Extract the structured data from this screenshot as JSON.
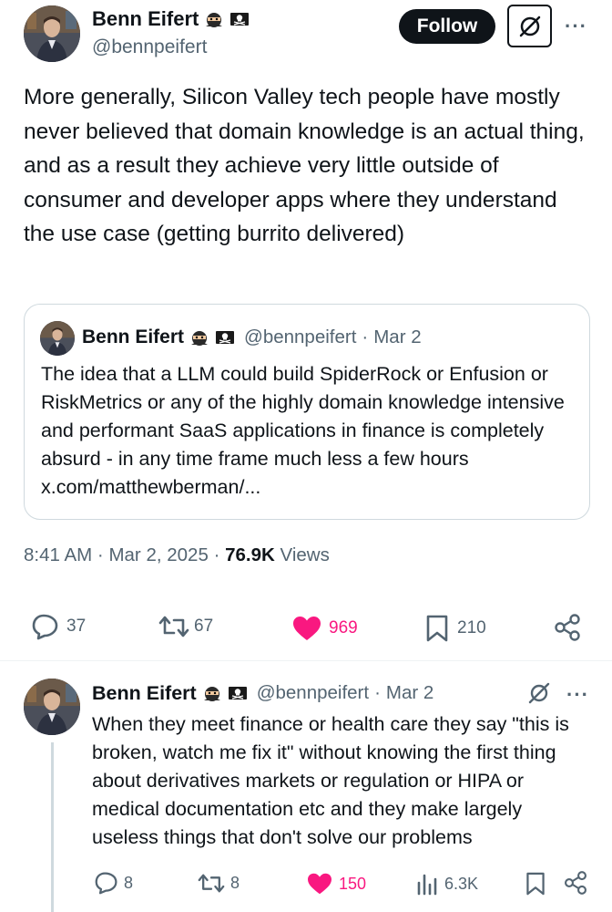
{
  "main_tweet": {
    "author_name": "Benn Eifert",
    "author_handle": "@bennpeifert",
    "follow_label": "Follow",
    "more_icon": "more-dots-icon",
    "text": "More generally, Silicon Valley tech people have mostly never believed that domain knowledge is an actual thing, and as a result they achieve very little outside of consumer and developer apps where they understand the use case (getting burrito delivered)",
    "quote": {
      "author_name": "Benn Eifert",
      "author_handle": "@bennpeifert",
      "dot": "·",
      "date": "Mar 2",
      "text": "The idea that a LLM could build SpiderRock or Enfusion or RiskMetrics or any of the highly domain knowledge intensive and performant SaaS applications in finance is completely absurd - in any time frame much less a few hours x.com/matthewberman/..."
    },
    "meta": {
      "time": "8:41 AM",
      "sep1": "·",
      "date": "Mar 2, 2025",
      "sep2": "·",
      "views_count": "76.9K",
      "views_label": "Views"
    },
    "actions": {
      "replies": "37",
      "reposts": "67",
      "likes": "969",
      "bookmarks": "210"
    }
  },
  "reply_tweet": {
    "author_name": "Benn Eifert",
    "author_handle": "@bennpeifert",
    "dot": "·",
    "date": "Mar 2",
    "text": "When they meet finance or health care they say \"this is broken, watch me fix it\" without knowing the first thing about derivatives markets or regulation or HIPA or medical documentation etc and they make largely useless things that don't solve our problems",
    "actions": {
      "replies": "8",
      "reposts": "8",
      "likes": "150",
      "views": "6.3K"
    }
  },
  "colors": {
    "text": "#0f1419",
    "secondary": "#536471",
    "like": "#f91880",
    "border": "#cfd9de"
  }
}
